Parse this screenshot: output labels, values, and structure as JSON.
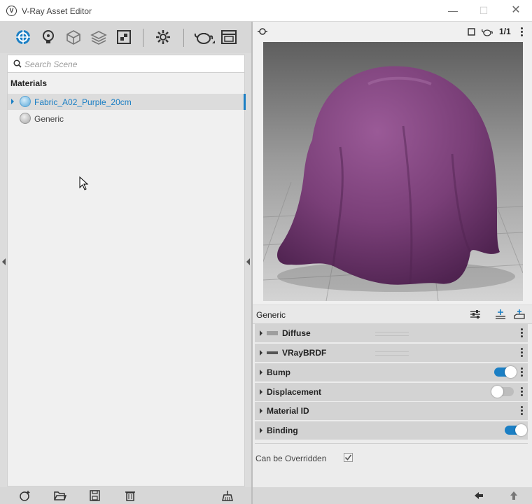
{
  "window": {
    "title": "V-Ray Asset Editor",
    "logo": "V"
  },
  "toolbar": {
    "icons": [
      "materials-icon",
      "lights-icon",
      "geometry-icon",
      "layers-icon",
      "render-elements-icon",
      "settings-icon",
      "render-teapot-icon",
      "frame-buffer-icon"
    ]
  },
  "search": {
    "placeholder": "Search Scene"
  },
  "materials": {
    "heading": "Materials",
    "items": [
      {
        "label": "Fabric_A02_Purple_20cm",
        "selected": true
      },
      {
        "label": "Generic",
        "selected": false
      }
    ]
  },
  "preview": {
    "counter": "1/1"
  },
  "properties": {
    "title": "Generic",
    "rows": [
      {
        "label": "Diffuse"
      },
      {
        "label": "VRayBRDF"
      },
      {
        "label": "Bump",
        "toggle": true
      },
      {
        "label": "Displacement",
        "toggle": false
      },
      {
        "label": "Material ID"
      },
      {
        "label": "Binding",
        "toggle": true
      }
    ],
    "override_label": "Can be Overridden",
    "override_checked": true
  },
  "colors": {
    "accent": "#1b7fc4",
    "fabric": "#7a3f78"
  }
}
